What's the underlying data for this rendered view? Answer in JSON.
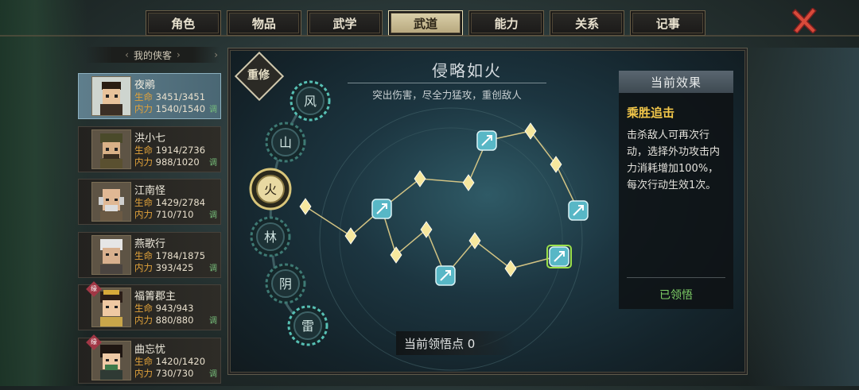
{
  "tabs": [
    {
      "label": "角色",
      "active": false
    },
    {
      "label": "物品",
      "active": false
    },
    {
      "label": "武学",
      "active": false
    },
    {
      "label": "武道",
      "active": true
    },
    {
      "label": "能力",
      "active": false
    },
    {
      "label": "关系",
      "active": false
    },
    {
      "label": "记事",
      "active": false
    }
  ],
  "sidebar": {
    "title": "我的侠客",
    "hp_label": "生命",
    "mp_label": "内力",
    "adjust_label": "调",
    "characters": [
      {
        "name": "夜鹇",
        "hp": "3451/3451",
        "mp": "1540/1540",
        "selected": true,
        "badge": ""
      },
      {
        "name": "洪小七",
        "hp": "1914/2736",
        "mp": "988/1020",
        "selected": false,
        "badge": ""
      },
      {
        "name": "江南怪",
        "hp": "1429/2784",
        "mp": "710/710",
        "selected": false,
        "badge": ""
      },
      {
        "name": "燕歌行",
        "hp": "1784/1875",
        "mp": "393/425",
        "selected": false,
        "badge": ""
      },
      {
        "name": "福箐郡主",
        "hp": "943/943",
        "mp": "880/880",
        "selected": false,
        "badge": "缘"
      },
      {
        "name": "曲忘忧",
        "hp": "1420/1420",
        "mp": "730/730",
        "selected": false,
        "badge": "缘"
      }
    ]
  },
  "panel": {
    "title": "侵略如火",
    "subtitle": "突出伤害，尽全力猛攻，重创敌人",
    "reset_label": "重修",
    "paths": [
      "风",
      "山",
      "火",
      "林",
      "阴",
      "雷"
    ],
    "active_path": "火",
    "points_text": "当前领悟点 0"
  },
  "effect": {
    "header": "当前效果",
    "name": "乘胜追击",
    "desc": "击杀敌人可再次行动，选择外功攻击内力消耗增加100%，每次行动生效1次。",
    "status": "已领悟"
  },
  "colors": {
    "accent_gold": "#f2c74a",
    "learned_green": "#7fd167",
    "stat_orange": "#e1a23a"
  }
}
